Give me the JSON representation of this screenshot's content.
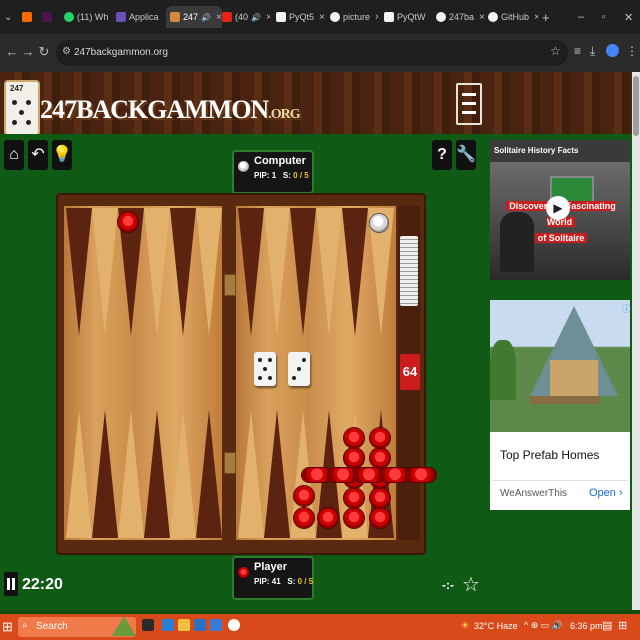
{
  "browser": {
    "tabs": [
      {
        "label": "(11) Wh",
        "icon": "whatsapp-icon",
        "color": "#25d366"
      },
      {
        "label": "Applica",
        "icon": "app-icon",
        "color": "#6b4fbb"
      },
      {
        "label": "247",
        "icon": "247-icon",
        "color": "#d38b3a",
        "active": true
      },
      {
        "label": "(40",
        "icon": "youtube-icon",
        "color": "#e62117"
      },
      {
        "label": "PyQt5",
        "icon": "doc-icon",
        "color": "#f2f2f2"
      },
      {
        "label": "picture",
        "icon": "google-icon",
        "color": "#f2f2f2"
      },
      {
        "label": "PyQtW",
        "icon": "doc-icon",
        "color": "#f2f2f2"
      },
      {
        "label": "247ba",
        "icon": "google-icon",
        "color": "#f2f2f2"
      },
      {
        "label": "GitHub",
        "icon": "github-icon",
        "color": "#f2f2f2"
      }
    ],
    "new_tab": "+",
    "url": "247backgammon.org"
  },
  "site": {
    "logo_main": "247BACKGAMMON",
    "logo_suffix": ".ORG",
    "die_label": "247"
  },
  "game": {
    "computer": {
      "name": "Computer",
      "pip_label": "PIP:",
      "pip": "1",
      "score_label": "S:",
      "score": "0 / 5"
    },
    "player": {
      "name": "Player",
      "pip_label": "PIP:",
      "pip": "41",
      "score_label": "S:",
      "score": "0 / 5"
    },
    "dice": [
      5,
      3
    ],
    "doubling_cube": "64",
    "timer": "22:20",
    "controls_glyph": "-:-"
  },
  "sidebar": {
    "video_title": "Solitaire History Facts",
    "video_banner_line1": "Discover the Fascinating World",
    "video_banner_line2": "of Solitaire",
    "ad_title": "Top Prefab Homes",
    "ad_source": "WeAnswerThis",
    "ad_button": "Open"
  },
  "taskbar": {
    "search_label": "Search",
    "weather": "32°C  Haze",
    "time": "6:36 pm"
  },
  "colors": {
    "felt": "#0f5a14",
    "checker_red": "#c80000",
    "accent_gold": "#f0c030",
    "taskbar": "#d94a1a"
  }
}
